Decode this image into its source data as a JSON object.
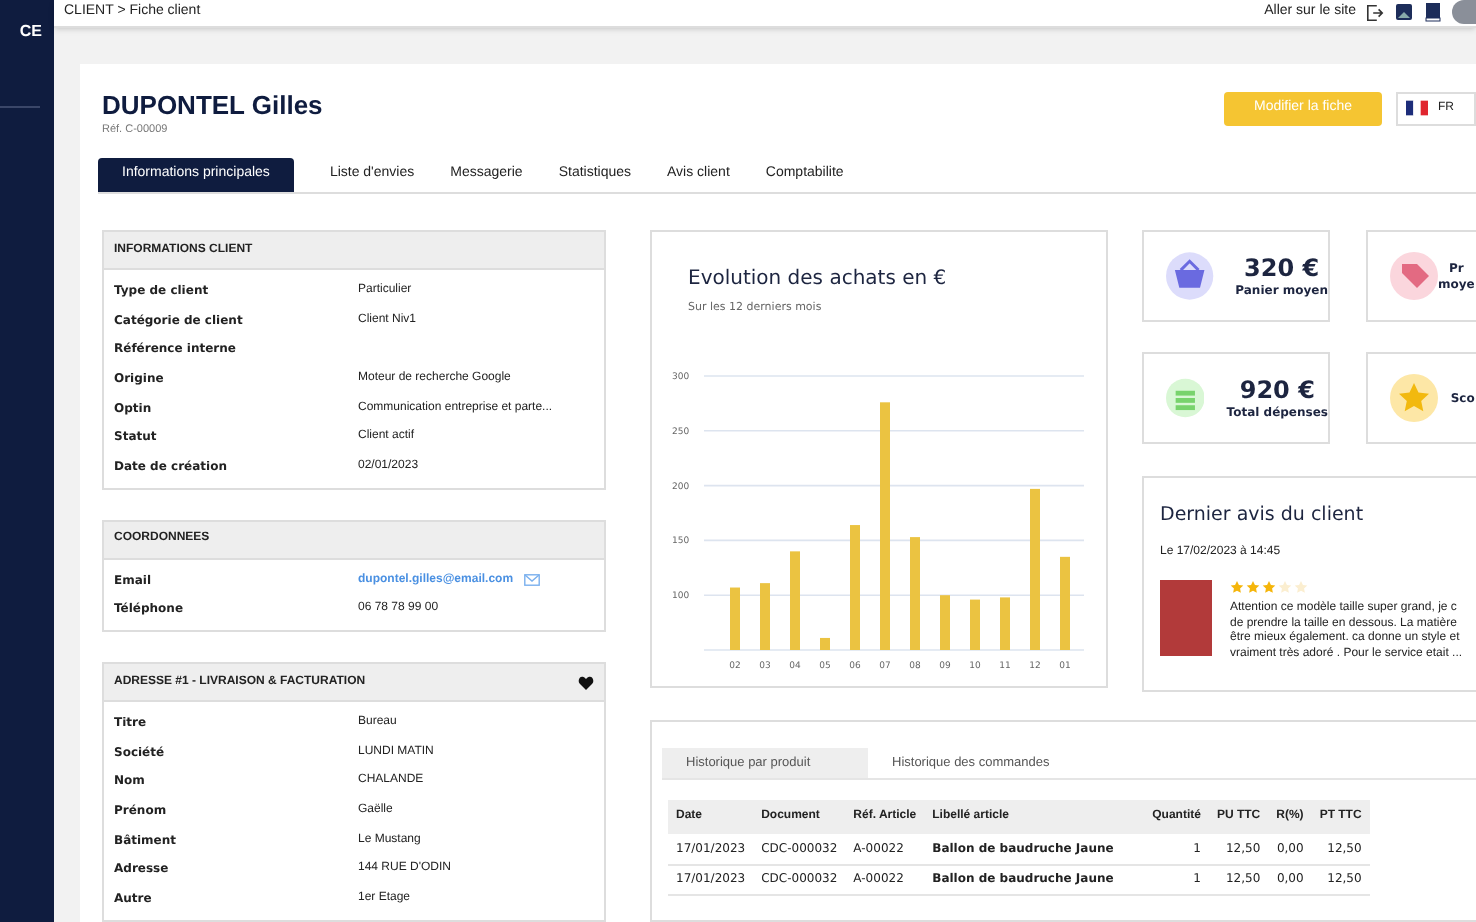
{
  "sidebar": {
    "logo_text": "CE"
  },
  "topbar": {
    "breadcrumb": "CLIENT > Fiche client",
    "site_link": "Aller sur le site"
  },
  "header": {
    "name": "DUPONTEL Gilles",
    "reference": "Réf. C-00009",
    "edit_button": "Modifier la fiche",
    "language": "FR"
  },
  "tabs": [
    {
      "label": "Informations principales",
      "selected": true
    },
    {
      "label": "Liste d'envies",
      "selected": false
    },
    {
      "label": "Messagerie",
      "selected": false
    },
    {
      "label": "Statistiques",
      "selected": false
    },
    {
      "label": "Avis client",
      "selected": false
    },
    {
      "label": "Comptabilite",
      "selected": false
    }
  ],
  "panels": [
    {
      "title": "INFORMATIONS CLIENT",
      "favorite": false,
      "rows": [
        {
          "kind": "text",
          "label": "Type de client",
          "value": "Particulier"
        },
        {
          "kind": "text",
          "label": "Catégorie de client",
          "value": "Client Niv1"
        },
        {
          "kind": "text",
          "label": "Référence interne"
        },
        {
          "kind": "text",
          "label": "Origine",
          "value": "Moteur de recherche Google"
        },
        {
          "kind": "text",
          "label": "Optin",
          "value": "Communication entreprise et parte..."
        },
        {
          "kind": "text",
          "label": "Statut",
          "value": "Client actif"
        },
        {
          "kind": "text",
          "label": "Date de création",
          "value": "02/01/2023"
        }
      ]
    },
    {
      "title": "COORDONNEES",
      "favorite": false,
      "rows": [
        {
          "kind": "email",
          "label": "Email",
          "value": "dupontel.gilles@email.com"
        },
        {
          "kind": "text",
          "label": "Téléphone",
          "value": "06 78 78 99 00"
        }
      ]
    },
    {
      "title": "ADRESSE #1 - LIVRAISON & FACTURATION",
      "favorite": true,
      "rows": [
        {
          "kind": "text",
          "label": "Titre",
          "value": "Bureau"
        },
        {
          "kind": "text",
          "label": "Société",
          "value": "LUNDI MATIN"
        },
        {
          "kind": "text",
          "label": "Nom",
          "value": "CHALANDE"
        },
        {
          "kind": "text",
          "label": "Prénom",
          "value": "Gaëlle"
        },
        {
          "kind": "text",
          "label": "Bâtiment",
          "value": "Le Mustang"
        },
        {
          "kind": "text",
          "label": "Adresse",
          "value": "144 RUE D'ODIN"
        },
        {
          "kind": "text",
          "label": "Autre",
          "value": "1er Etage"
        }
      ]
    }
  ],
  "chart_card": {
    "title": "Evolution des achats en €",
    "subtitle": "Sur les 12 derniers mois",
    "chart_data": {
      "type": "bar",
      "categories": [
        "02",
        "03",
        "04",
        "05",
        "06",
        "07",
        "08",
        "09",
        "10",
        "11",
        "12",
        "01"
      ],
      "grid": true,
      "series": [
        {
          "color": "#ebc341",
          "values": [
            107,
            111,
            140,
            61,
            164,
            276,
            153,
            100,
            96,
            98,
            197,
            135
          ]
        }
      ],
      "ylim": [
        50,
        300
      ],
      "yticks": [
        100,
        150,
        200,
        250,
        300
      ]
    }
  },
  "stats": [
    {
      "kind": "basket",
      "value": "320 €",
      "label_lines": [
        "Panier moyen"
      ]
    },
    {
      "kind": "tag",
      "label_lines": [
        "Pr",
        "moye"
      ]
    },
    {
      "kind": "coins",
      "value": "920 €",
      "label_lines": [
        "Total dépenses"
      ]
    },
    {
      "kind": "star",
      "label_lines": [
        "Sco"
      ]
    }
  ],
  "review": {
    "title": "Dernier avis du client",
    "date": "Le 17/02/2023 à 14:45",
    "stars": 3,
    "text_lines": [
      "Attention ce modèle taille super grand, je c",
      "de prendre la taille en dessous. La matière",
      "être mieux également. ca donne un style et",
      "vraiment très adoré . Pour le service etait ..."
    ]
  },
  "history": {
    "tabs": [
      {
        "label": "Historique par produit",
        "selected": true
      },
      {
        "label": "Historique des commandes",
        "selected": false
      }
    ],
    "columns": [
      "Date",
      "Document",
      "Réf. Article",
      "Libellé article",
      "Quantité",
      "PU TTC",
      "R(%)",
      "PT TTC"
    ],
    "rows": [
      [
        "17/01/2023",
        "CDC-000032",
        "A-00022",
        "Ballon de baudruche Jaune",
        "1",
        "12,50",
        "0,00",
        "12,50"
      ],
      [
        "17/01/2023",
        "CDC-000032",
        "A-00022",
        "Ballon de baudruche Jaune",
        "1",
        "12,50",
        "0,00",
        "12,50"
      ]
    ]
  }
}
